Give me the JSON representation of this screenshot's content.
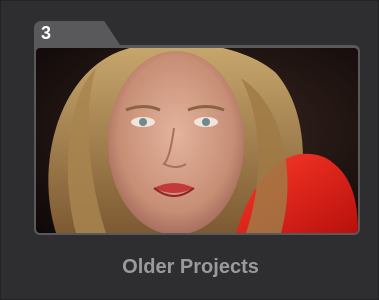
{
  "project_folder": {
    "count": "3",
    "label": "Older Projects",
    "thumbnail_icon": "project-thumbnail-icon"
  },
  "colors": {
    "tile_background": "#2e2e31",
    "folder": "#59595c",
    "label_text": "#9a9a9e",
    "count_text": "#ffffff"
  }
}
